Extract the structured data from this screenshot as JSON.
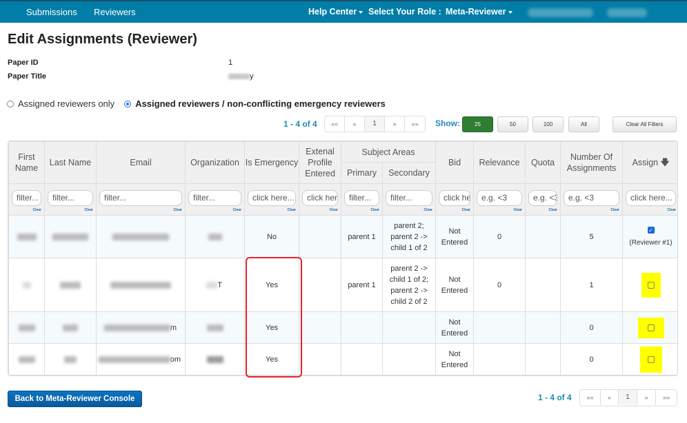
{
  "nav": {
    "submissions": "Submissions",
    "reviewers": "Reviewers",
    "help_center": "Help Center",
    "select_role_label": "Select Your Role :",
    "role": "Meta-Reviewer"
  },
  "page": {
    "title": "Edit Assignments (Reviewer)",
    "paper_id_label": "Paper ID",
    "paper_id": "1",
    "paper_title_label": "Paper Title",
    "paper_title_visible_suffix": "y"
  },
  "view_options": {
    "option1": "Assigned reviewers only",
    "option2": "Assigned reviewers / non-conflicting emergency reviewers",
    "selected": "option2"
  },
  "pagination": {
    "count": "1 - 4 of 4",
    "first": "««",
    "prev": "«",
    "page": "1",
    "next": "»",
    "last": "»»"
  },
  "show": {
    "label": "Show:",
    "options": [
      "25",
      "50",
      "100",
      "All"
    ],
    "selected": "25",
    "clear_filters": "Clear All Filters"
  },
  "table": {
    "headers": {
      "first_name": "First Name",
      "last_name": "Last Name",
      "email": "Email",
      "organization": "Organization",
      "is_emergency": "Is Emergency",
      "external_profile": "Extenal Profile Entered",
      "subject_areas": "Subject Areas",
      "primary": "Primary",
      "secondary": "Secondary",
      "bid": "Bid",
      "relevance": "Relevance",
      "quota": "Quota",
      "num_assignments": "Number Of Assignments",
      "assign": "Assign"
    },
    "filters": {
      "first_name": "filter...",
      "last_name": "filter...",
      "email": "filter...",
      "organization": "filter...",
      "is_emergency": "click here...",
      "external_profile": "click here...",
      "primary": "filter...",
      "secondary": "filter...",
      "bid": "click here...",
      "relevance": "e.g. <3",
      "quota": "e.g. <3",
      "num_assignments": "e.g. <3",
      "assign": "click here...",
      "clear": "Clear"
    },
    "rows": [
      {
        "email_suffix": "",
        "org_suffix": "",
        "is_emergency": "No",
        "external_profile": "",
        "primary": "parent 1",
        "secondary": "parent 2; parent 2 -> child 1 of 2",
        "bid": "Not Entered",
        "relevance": "0",
        "quota": "",
        "num_assignments": "5",
        "assigned": true,
        "assign_note": "(Reviewer #1)"
      },
      {
        "email_suffix": "",
        "org_suffix": "T",
        "is_emergency": "Yes",
        "external_profile": "",
        "primary": "parent 1",
        "secondary": "parent 2 -> child 1 of 2; parent 2 -> child 2 of 2",
        "bid": "Not Entered",
        "relevance": "0",
        "quota": "",
        "num_assignments": "1",
        "assigned": false,
        "assign_note": ""
      },
      {
        "email_suffix": "m",
        "org_suffix": "",
        "is_emergency": "Yes",
        "external_profile": "",
        "primary": "",
        "secondary": "",
        "bid": "Not Entered",
        "relevance": "",
        "quota": "",
        "num_assignments": "0",
        "assigned": false,
        "assign_note": ""
      },
      {
        "email_suffix": "om",
        "org_suffix": "",
        "is_emergency": "Yes",
        "external_profile": "",
        "primary": "",
        "secondary": "",
        "bid": "Not Entered",
        "relevance": "",
        "quota": "",
        "num_assignments": "0",
        "assigned": false,
        "assign_note": ""
      }
    ]
  },
  "footer": {
    "back_button": "Back to Meta-Reviewer Console"
  },
  "colors": {
    "nav_bg": "#017ea7",
    "accent_text": "#1f8ab8",
    "active_show": "#2e7d32",
    "highlight": "#ffff00",
    "annotation_box": "#e3242b"
  }
}
